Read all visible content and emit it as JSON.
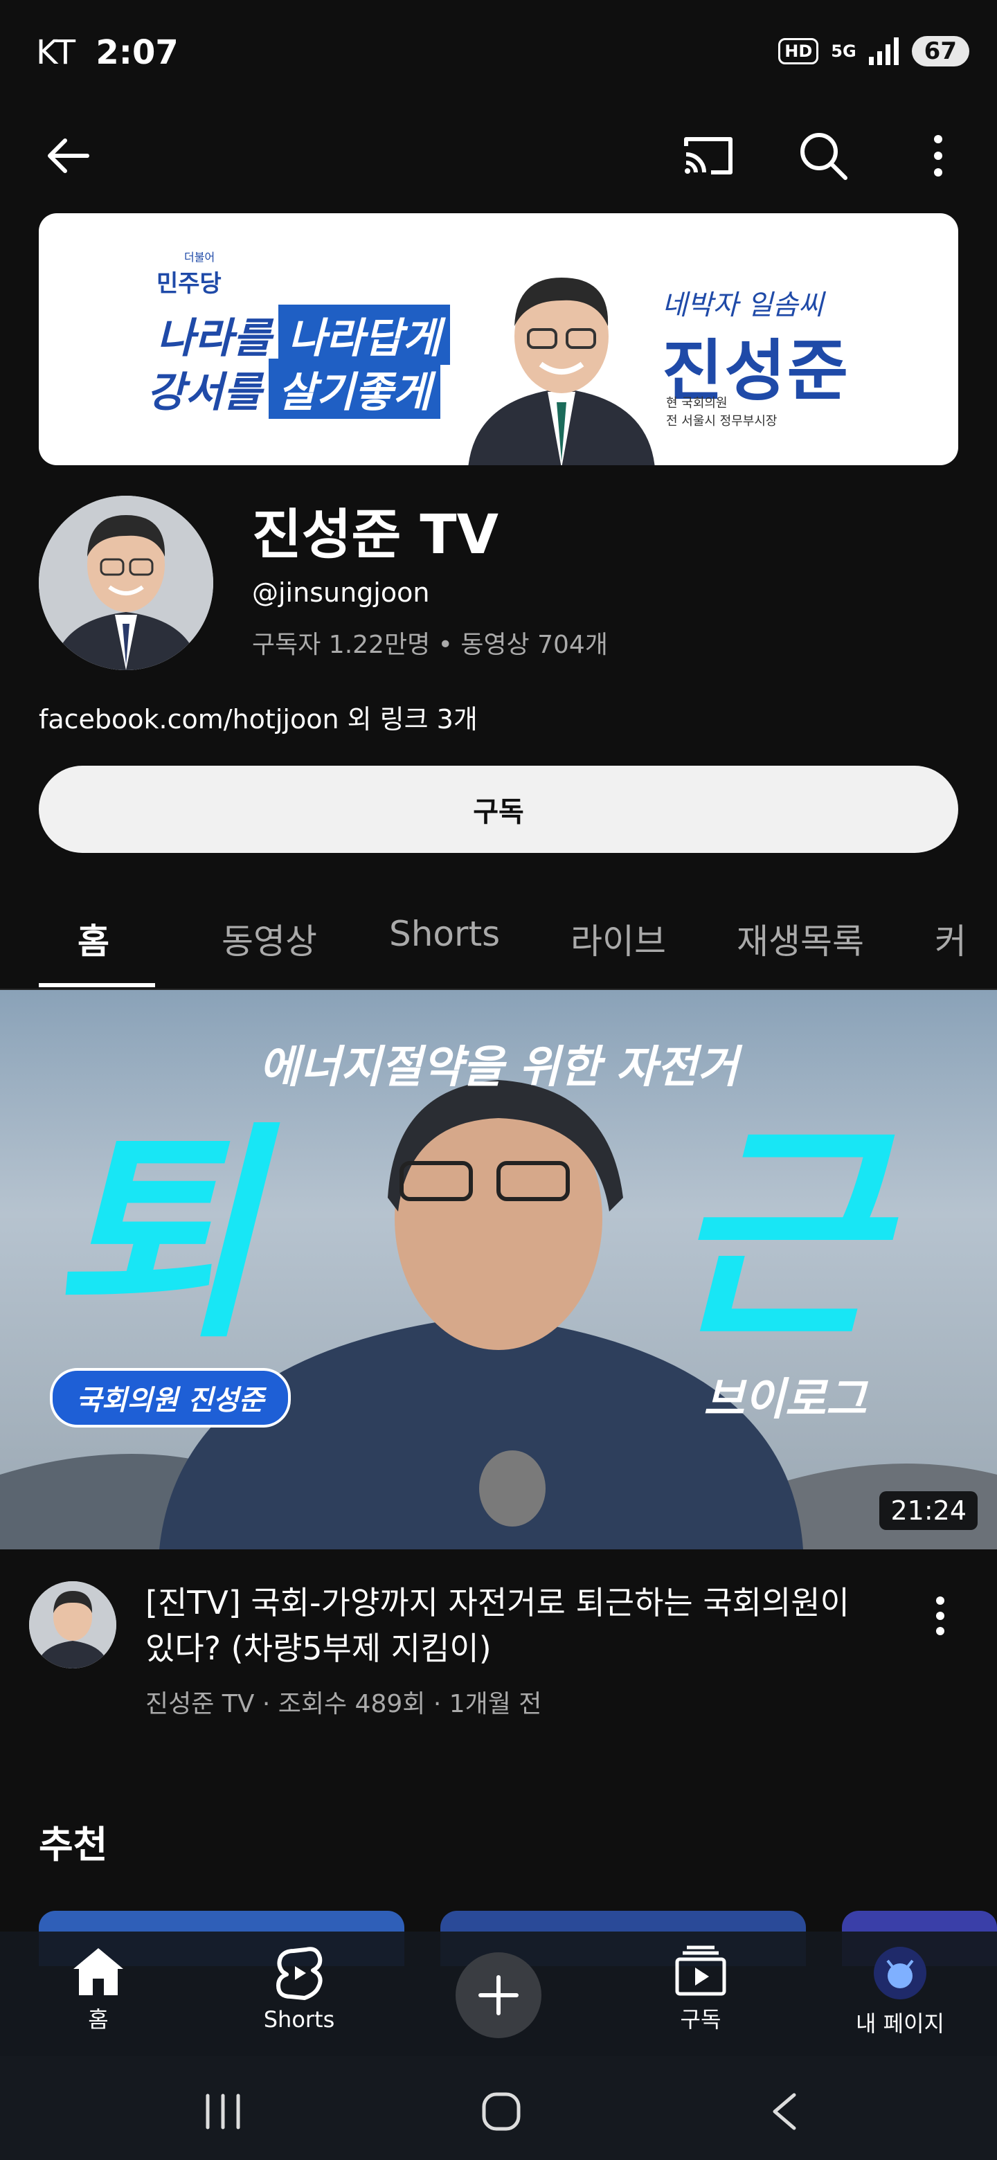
{
  "status_bar": {
    "carrier": "KT",
    "time": "2:07",
    "hd_badge": "HD",
    "network": "5G",
    "battery": "67"
  },
  "app_bar": {
    "icons": [
      "back-arrow-icon",
      "cast-icon",
      "search-icon",
      "more-vert-icon"
    ]
  },
  "banner": {
    "party_small": "더불어",
    "party": "민주당",
    "slogan_line1_plain": "나라를",
    "slogan_line1_boxed": "나라답게",
    "slogan_line2_plain": "강서를",
    "slogan_line2_boxed": "살기좋게",
    "handwriting": "네박자 일솜씨",
    "candidate": "진성준",
    "career_line1": "현 국회의원",
    "career_line2": "전 서울시 정무부시장"
  },
  "channel": {
    "title": "진성준 TV",
    "handle": "@jinsungjoon",
    "stats": "구독자 1.22만명 • 동영상 704개",
    "link": "facebook.com/hotjjoon",
    "link_more": " 외 링크 3개",
    "subscribe_label": "구독"
  },
  "tabs": [
    {
      "label": "홈",
      "active": true
    },
    {
      "label": "동영상",
      "active": false
    },
    {
      "label": "Shorts",
      "active": false
    },
    {
      "label": "라이브",
      "active": false
    },
    {
      "label": "재생목록",
      "active": false
    },
    {
      "label": "커",
      "active": false
    }
  ],
  "video": {
    "thumb_top_text": "에너지절약을 위한 자전거",
    "thumb_big_left": "퇴",
    "thumb_big_right": "근",
    "thumb_pill": "국회의원 진성준",
    "thumb_vlog": "브이로그",
    "duration": "21:24",
    "title": "[진TV] 국회-가양까지 자전거로 퇴근하는 국회의원이 있다? (차량5부제 지킴이)",
    "meta": "진성준 TV · 조회수 489회 · 1개월 전"
  },
  "recommended_title": "추천",
  "bottom_nav": {
    "home": "홈",
    "shorts": "Shorts",
    "subscriptions": "구독",
    "my_page": "내 페이지"
  },
  "colors": {
    "background": "#0f0f0f",
    "subscribe_bg": "#f1f1f1",
    "thumb_cyan": "#18e6f5",
    "party_blue": "#1f4aa8"
  }
}
